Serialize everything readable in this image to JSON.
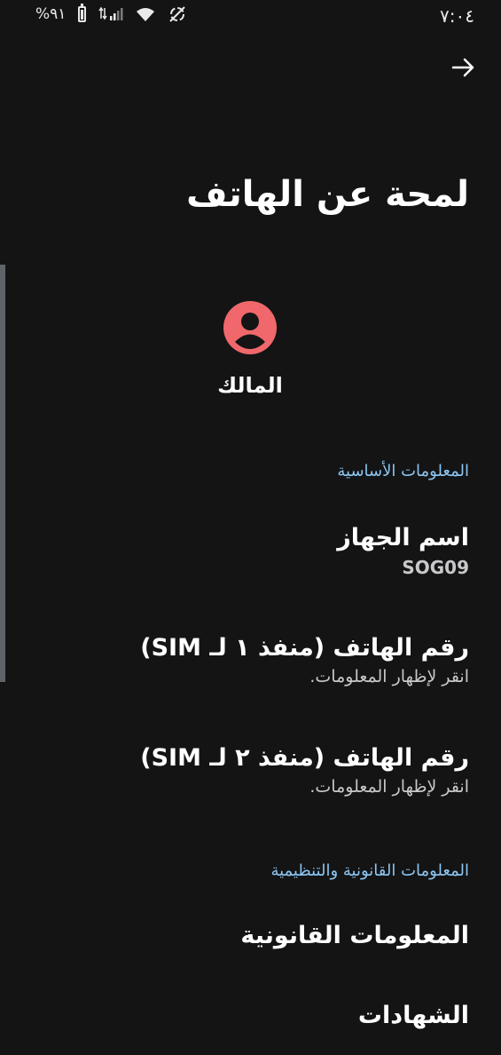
{
  "status_bar": {
    "battery_percent": "%٩١",
    "time": "٧:٠٤",
    "icons": [
      "battery-icon",
      "signal-icon",
      "wifi-icon",
      "data-saver-icon"
    ]
  },
  "header": {
    "title": "لمحة عن الهاتف",
    "back_icon": "arrow-right-icon"
  },
  "owner": {
    "label": "المالك",
    "avatar_color": "#f0686c"
  },
  "sections": {
    "basic": {
      "header": "المعلومات الأساسية",
      "items": [
        {
          "title": "اسم الجهاز",
          "subtitle": "SOG09"
        },
        {
          "title": "رقم الهاتف (منفذ ١ لـ SIM)",
          "subtitle": "انقر لإظهار المعلومات."
        },
        {
          "title": "رقم الهاتف (منفذ ٢ لـ SIM)",
          "subtitle": "انقر لإظهار المعلومات."
        }
      ]
    },
    "legal": {
      "header": "المعلومات القانونية والتنظيمية",
      "items": [
        {
          "title": "المعلومات القانونية"
        },
        {
          "title": "الشهادات"
        }
      ]
    }
  },
  "colors": {
    "background": "#141415",
    "accent": "#8cc6f2",
    "avatar": "#f0686c"
  }
}
